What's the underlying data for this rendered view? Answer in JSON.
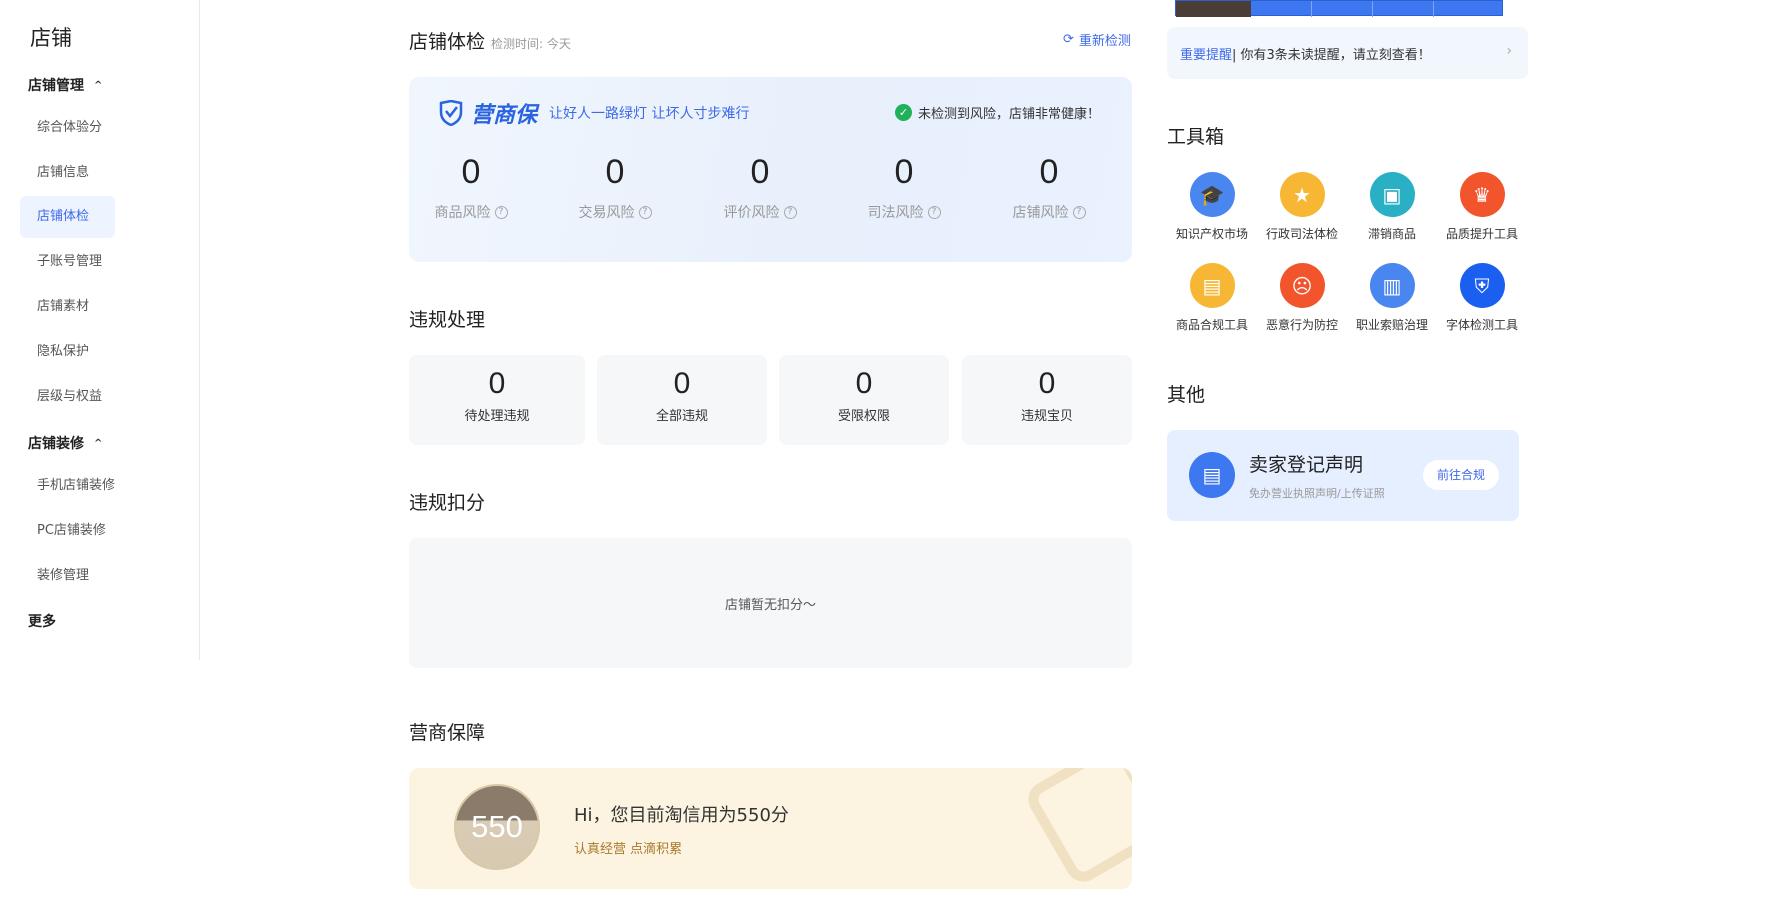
{
  "sidebar": {
    "title": "店铺",
    "groups": [
      {
        "label": "店铺管理"
      },
      {
        "label": "店铺装修"
      },
      {
        "label": "更多"
      }
    ],
    "items": [
      {
        "label": "综合体验分"
      },
      {
        "label": "店铺信息"
      },
      {
        "label": "店铺体检"
      },
      {
        "label": "子账号管理"
      },
      {
        "label": "店铺素材"
      },
      {
        "label": "隐私保护"
      },
      {
        "label": "层级与权益"
      },
      {
        "label": "手机店铺装修"
      },
      {
        "label": "PC店铺装修"
      },
      {
        "label": "装修管理"
      }
    ]
  },
  "health_check": {
    "title": "店铺体检",
    "check_time": "检测时间: 今天",
    "recheck_label": "重新检测",
    "brand_name": "营商保",
    "slogan": "让好人一路绿灯 让坏人寸步难行",
    "status": "未检测到风险，店铺非常健康！",
    "risks": [
      {
        "value": "0",
        "label": "商品风险"
      },
      {
        "value": "0",
        "label": "交易风险"
      },
      {
        "value": "0",
        "label": "评价风险"
      },
      {
        "value": "0",
        "label": "司法风险"
      },
      {
        "value": "0",
        "label": "店铺风险"
      }
    ]
  },
  "violation": {
    "title": "违规处理",
    "items": [
      {
        "value": "0",
        "label": "待处理违规"
      },
      {
        "value": "0",
        "label": "全部违规"
      },
      {
        "value": "0",
        "label": "受限权限"
      },
      {
        "value": "0",
        "label": "违规宝贝"
      }
    ]
  },
  "deduction": {
    "title": "违规扣分",
    "empty_text": "店铺暂无扣分～"
  },
  "guarantee": {
    "title": "营商保障",
    "score": "550",
    "headline": "Hi，您目前淘信用为550分",
    "sub": "认真经营 点滴积累"
  },
  "notice": {
    "highlight": "重要提醒",
    "text": " | 你有3条未读提醒，请立刻查看！"
  },
  "toolbox": {
    "title": "工具箱",
    "tools": [
      {
        "label": "知识产权市场",
        "icon": "graduation-cap-icon",
        "color": "#4a86ef"
      },
      {
        "label": "行政司法体检",
        "icon": "shield-badge-icon",
        "color": "#f7b735"
      },
      {
        "label": "滞销商品",
        "icon": "shopping-bag-icon",
        "color": "#2ab0c4"
      },
      {
        "label": "品质提升工具",
        "icon": "crown-icon",
        "color": "#f2552c"
      },
      {
        "label": "商品合规工具",
        "icon": "briefcase-icon",
        "color": "#f7b735"
      },
      {
        "label": "恶意行为防控",
        "icon": "frown-face-icon",
        "color": "#f2552c"
      },
      {
        "label": "职业索赔治理",
        "icon": "clipboard-icon",
        "color": "#4a86ef"
      },
      {
        "label": "字体检测工具",
        "icon": "font-shield-icon",
        "color": "#1a5ff0"
      }
    ]
  },
  "other": {
    "title": "其他",
    "card_title": "卖家登记声明",
    "card_sub": "免办营业执照声明/上传证照",
    "button": "前往合规"
  }
}
